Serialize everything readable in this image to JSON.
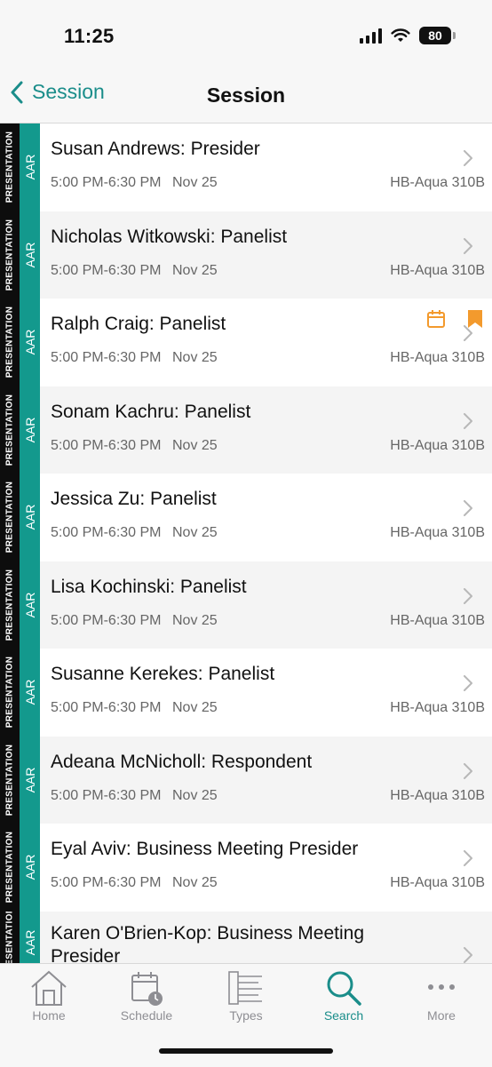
{
  "status_bar": {
    "time": "11:25",
    "battery": "80"
  },
  "nav": {
    "back_label": "Session",
    "title": "Session"
  },
  "colors": {
    "accent": "#1a8d8a",
    "type_strip": "#13998d",
    "favorite": "#f39a2d"
  },
  "rows": [
    {
      "type": "PRESENTATION",
      "org": "AAR",
      "title": "Susan Andrews: Presider",
      "time": "5:00 PM-6:30 PM",
      "date": "Nov 25",
      "location": "HB-Aqua 310B"
    },
    {
      "type": "PRESENTATION",
      "org": "AAR",
      "title": "Nicholas Witkowski: Panelist",
      "time": "5:00 PM-6:30 PM",
      "date": "Nov 25",
      "location": "HB-Aqua 310B"
    },
    {
      "type": "PRESENTATION",
      "org": "AAR",
      "title": "Ralph Craig: Panelist",
      "time": "5:00 PM-6:30 PM",
      "date": "Nov 25",
      "location": "HB-Aqua 310B",
      "icons": [
        "calendar-icon",
        "bookmark-icon"
      ]
    },
    {
      "type": "PRESENTATION",
      "org": "AAR",
      "title": "Sonam Kachru: Panelist",
      "time": "5:00 PM-6:30 PM",
      "date": "Nov 25",
      "location": "HB-Aqua 310B"
    },
    {
      "type": "PRESENTATION",
      "org": "AAR",
      "title": "Jessica Zu: Panelist",
      "time": "5:00 PM-6:30 PM",
      "date": "Nov 25",
      "location": "HB-Aqua 310B"
    },
    {
      "type": "PRESENTATION",
      "org": "AAR",
      "title": "Lisa Kochinski: Panelist",
      "time": "5:00 PM-6:30 PM",
      "date": "Nov 25",
      "location": "HB-Aqua 310B"
    },
    {
      "type": "PRESENTATION",
      "org": "AAR",
      "title": "Susanne Kerekes: Panelist",
      "time": "5:00 PM-6:30 PM",
      "date": "Nov 25",
      "location": "HB-Aqua 310B"
    },
    {
      "type": "PRESENTATION",
      "org": "AAR",
      "title": "Adeana McNicholl: Respondent",
      "time": "5:00 PM-6:30 PM",
      "date": "Nov 25",
      "location": "HB-Aqua 310B"
    },
    {
      "type": "PRESENTATION",
      "org": "AAR",
      "title": "Eyal Aviv: Business Meeting Presider",
      "time": "5:00 PM-6:30 PM",
      "date": "Nov 25",
      "location": "HB-Aqua 310B"
    },
    {
      "type": "PRESENTATION",
      "org": "AAR",
      "title": "Karen O'Brien-Kop: Business Meeting Presider",
      "time": "",
      "date": "",
      "location": ""
    }
  ],
  "tabs": [
    {
      "label": "Home",
      "icon": "home-icon"
    },
    {
      "label": "Schedule",
      "icon": "schedule-icon"
    },
    {
      "label": "Types",
      "icon": "types-icon"
    },
    {
      "label": "Search",
      "icon": "search-icon",
      "active": true
    },
    {
      "label": "More",
      "icon": "more-icon"
    }
  ]
}
